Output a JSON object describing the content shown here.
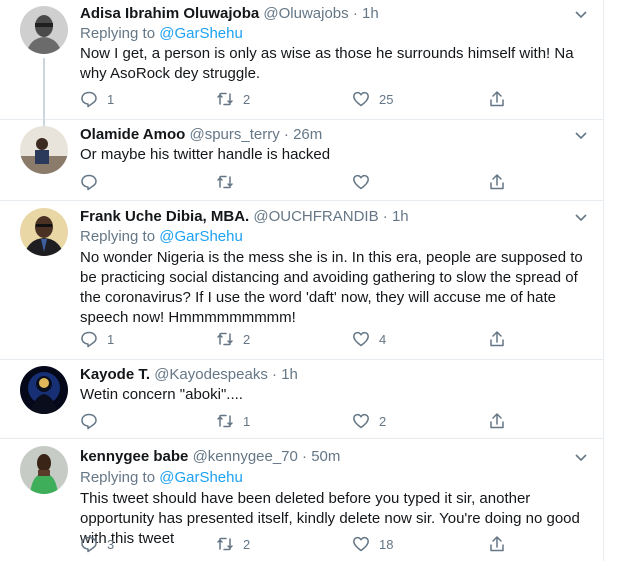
{
  "tweets": [
    {
      "name": "Adisa Ibrahim Oluwajoba",
      "handle": "@Oluwajobs",
      "time": "1h",
      "replying_prefix": "Replying to",
      "replying_to": "@GarShehu",
      "text": "Now I get, a person is only as wise as those he surrounds himself with! Na why AsoRock dey struggle.",
      "replies": "1",
      "retweets": "2",
      "likes": "25"
    },
    {
      "name": "Olamide Amoo",
      "handle": "@spurs_terry",
      "time": "26m",
      "text": "Or maybe his twitter handle is hacked",
      "replies": "",
      "retweets": "",
      "likes": ""
    },
    {
      "name": "Frank Uche Dibia, MBA.",
      "handle": "@OUCHFRANDIB",
      "time": "1h",
      "replying_prefix": "Replying to",
      "replying_to": "@GarShehu",
      "text": "No wonder Nigeria is the mess she is in. In this era, people are supposed to be practicing social distancing and avoiding gathering to slow the spread of the coronavirus? If I use the word 'daft' now, they will accuse me of hate speech now! Hmmmmmmmmm!",
      "replies": "1",
      "retweets": "2",
      "likes": "4"
    },
    {
      "name": "Kayode T.",
      "handle": "@Kayodespeaks",
      "time": "1h",
      "text": "Wetin concern \"aboki\"....",
      "replies": "",
      "retweets": "1",
      "likes": "2"
    },
    {
      "name": "kennygee babe",
      "handle": "@kennygee_70",
      "time": "50m",
      "replying_prefix": "Replying to",
      "replying_to": "@GarShehu",
      "text": "This tweet should have been deleted before you typed it sir, another opportunity has presented itself, kindly delete now sir. You're doing no good with this tweet",
      "replies": "3",
      "retweets": "2",
      "likes": "18"
    }
  ],
  "separator": "·",
  "icons": {
    "reply": "reply-icon",
    "retweet": "retweet-icon",
    "like": "heart-icon",
    "share": "share-icon",
    "caret": "chevron-down-icon"
  },
  "colors": {
    "link": "#1da1f2",
    "secondary_text": "#657786",
    "border": "#e6ecf0",
    "thread_line": "#ccd6dd"
  }
}
